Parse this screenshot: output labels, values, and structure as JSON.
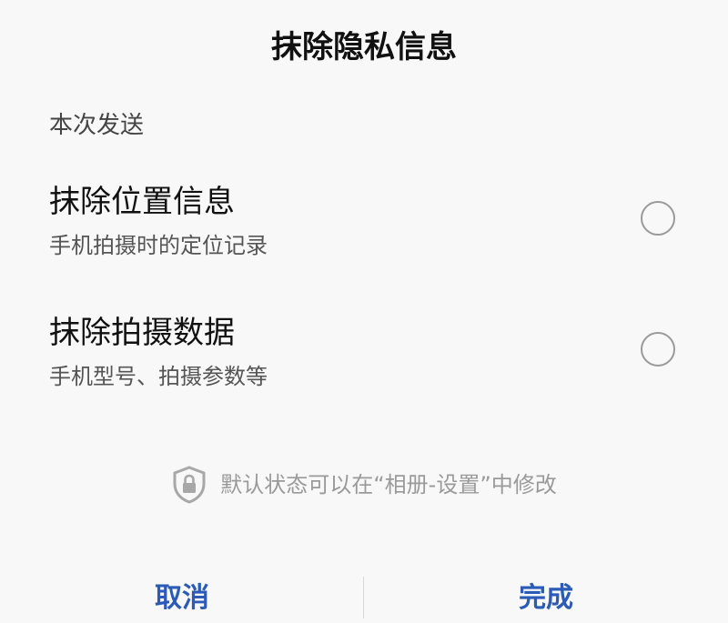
{
  "dialog": {
    "title": "抹除隐私信息",
    "section_label": "本次发送",
    "options": [
      {
        "title": "抹除位置信息",
        "subtitle": "手机拍摄时的定位记录",
        "checked": false
      },
      {
        "title": "抹除拍摄数据",
        "subtitle": "手机型号、拍摄参数等",
        "checked": false
      }
    ],
    "hint": {
      "icon": "shield-lock-icon",
      "text": "默认状态可以在“相册-设置”中修改"
    },
    "buttons": {
      "cancel": "取消",
      "done": "完成"
    }
  },
  "colors": {
    "accent": "#2a5bb6",
    "background": "#f8f8f8",
    "hint": "#9a9a9a"
  }
}
